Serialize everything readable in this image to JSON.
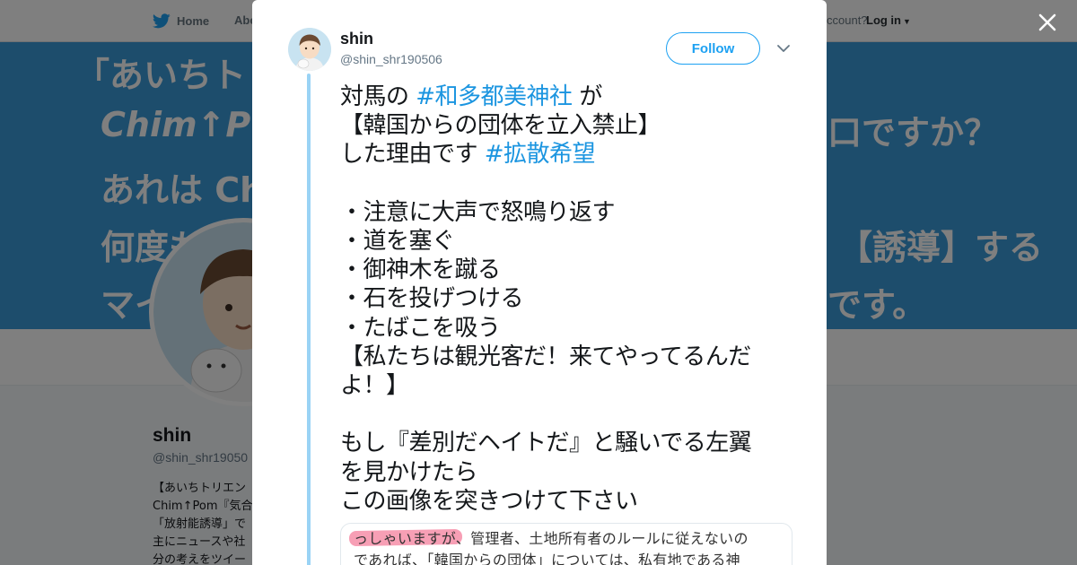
{
  "topbar": {
    "home_label": "Home",
    "about_label": "Abo",
    "account_text": "ccount?",
    "login_label": "Log in"
  },
  "banner": {
    "lines": [
      "「あいちトリ",
      "Chim↑P",
      "あれは Ch",
      "何度も",
      "マイ",
      "口ですか？",
      "【誘導】する",
      "です。"
    ]
  },
  "profile": {
    "name": "shin",
    "handle": "@shin_shr19050",
    "bio": "【あいちトリエン\nChim↑Pom『気合\n「放射能誘導」で\n主にニュースや社\n分の考えをツイー"
  },
  "tweet": {
    "author_name": "shin",
    "author_handle": "@shin_shr190506",
    "follow_label": "Follow",
    "line1_pre": "対馬の ",
    "line1_tag": "#和多都美神社",
    "line1_post": " が",
    "line2": "【韓国からの団体を立入禁止】",
    "line3_pre": "した理由です ",
    "line3_tag": "#拡散希望",
    "item1": "・注意に大声で怒鳴り返す",
    "item2": "・道を塞ぐ",
    "item3": "・御神木を蹴る",
    "item4": "・石を投げつける",
    "item5": "・たばこを吸う",
    "quote1": "【私たちは観光客だ！来てやってるんだ",
    "quote2": "よ！】",
    "para1": "もし『差別だヘイトだ』と騒いでる左翼",
    "para2": "を見かけたら",
    "para3": "この画像を突きつけて下さい"
  },
  "quote_image": {
    "line1": "っしゃいますが、管理者、土地所有者のルールに従えないの",
    "line2": "であれば、「韓国からの団体」については、私有地である神"
  },
  "colors": {
    "twitter_blue": "#1da1f2",
    "hashtag": "#1b95e0",
    "banner": "#3b9bd9",
    "thread_line": "#9ad3f5"
  },
  "icons": [
    "twitter-bird-icon",
    "close-icon",
    "chevron-down-icon",
    "caret-down-icon"
  ]
}
